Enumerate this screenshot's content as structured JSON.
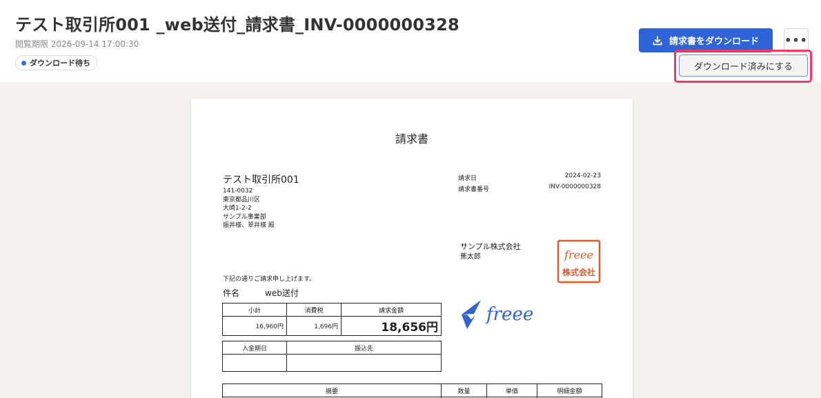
{
  "header": {
    "title": "テスト取引所001 _web送付_請求書_INV-0000000328",
    "deadline": "閲覧期限 2026-09-14 17:00:30",
    "status": "ダウンロード待ち",
    "download_button": "請求書をダウンロード",
    "more_button": "•••"
  },
  "menu": {
    "mark_downloaded": "ダウンロード済みにする"
  },
  "colors": {
    "primary": "#2f64d6",
    "status_dot": "#2f6fe0",
    "highlight": "#f0386b",
    "stamp": "#e05a2a",
    "logo": "#2f64d6"
  },
  "invoice": {
    "doc_title": "請求書",
    "client_name": "テスト取引所001",
    "client_postal": "141-0032",
    "client_address1": "東京都品川区",
    "client_address2": "大崎1-2-2",
    "client_dept": "サンプル事業部",
    "client_person": "振井様、翠井様 殿",
    "date_label": "請求日",
    "date_value": "2024-02-23",
    "number_label": "請求書番号",
    "number_value": "INV-0000000328",
    "company_name": "サンプル株式会社",
    "company_person": "蕉太郎",
    "stamp_top": "freee",
    "stamp_bottom": "株式会社",
    "note": "下記の通りご請求申し上げます。",
    "subject_label": "件名",
    "subject_value": "web送付",
    "totals": {
      "headers": [
        "小計",
        "消費税",
        "請求金額"
      ],
      "values": [
        "16,960円",
        "1,696円",
        "18,656円"
      ]
    },
    "payment": {
      "headers": [
        "入金期日",
        "振込先"
      ],
      "values": [
        "",
        ""
      ]
    },
    "items_headers": [
      "摘要",
      "数量",
      "単価",
      "明細金額"
    ],
    "logo_text": "freee",
    "logo_icon": "freee-bird-icon"
  }
}
